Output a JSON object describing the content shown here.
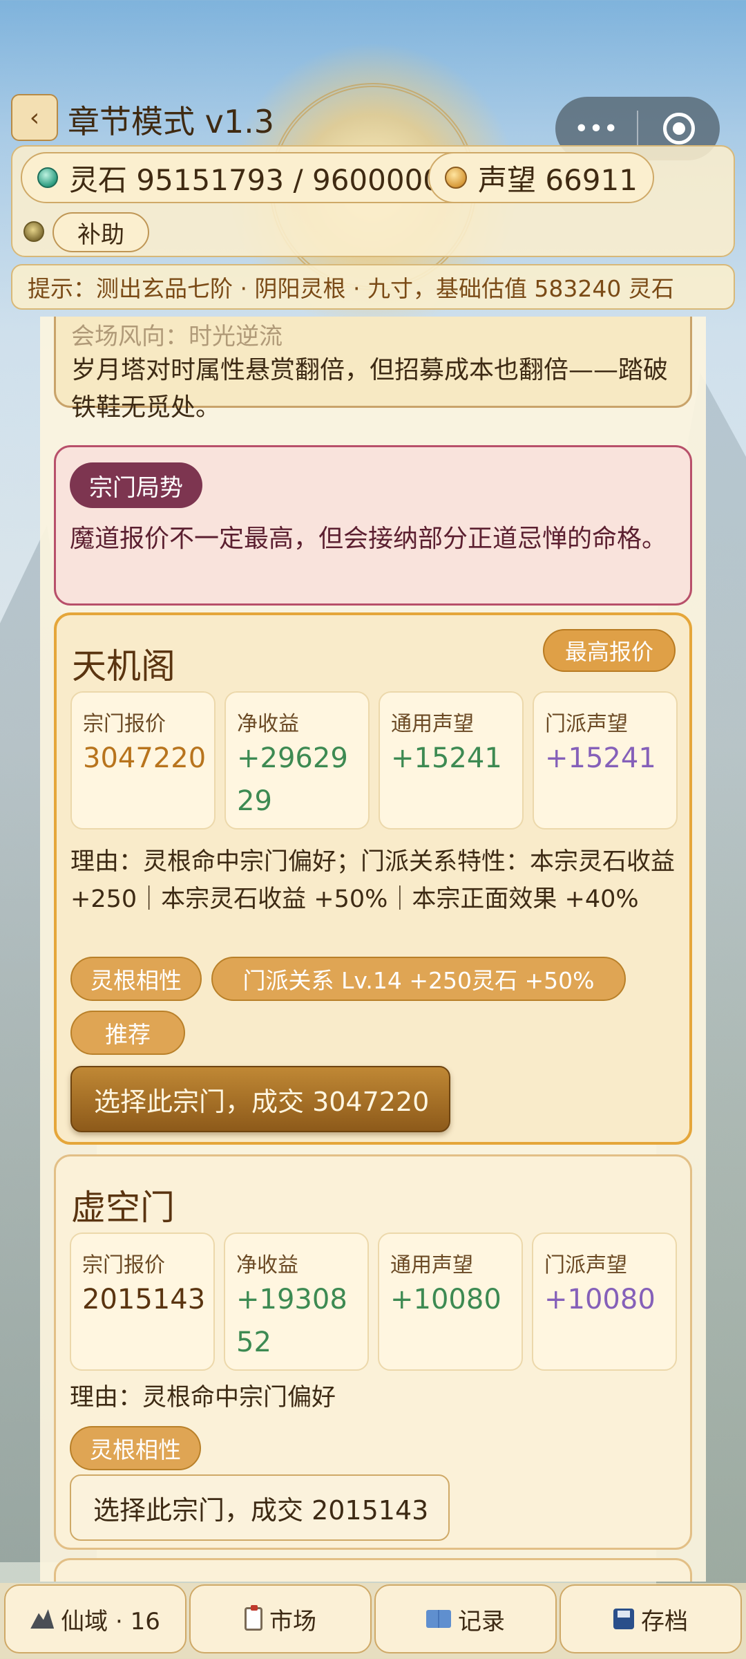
{
  "header": {
    "back_glyph": "‹",
    "title": "章节模式 v1.3",
    "capsule": {
      "menu_glyph": "•••"
    }
  },
  "resources": {
    "spirit_stone": "灵石 95151793 / 96000000",
    "reputation": "声望 66911",
    "assist_label": "补助"
  },
  "hint": "提示：测出玄品七阶 · 阴阳灵根 · 九寸，基础估值 583240 灵石",
  "event_card": {
    "ghost_title": "会场风向：时光逆流",
    "text": "岁月塔对时属性悬赏翻倍，但招募成本也翻倍——踏破铁鞋无觅处。"
  },
  "faction_card": {
    "tag": "宗门局势",
    "text": "魔道报价不一定最高，但会接纳部分正道忌惮的命格。"
  },
  "sects": [
    {
      "name": "天机阁",
      "badge": "最高报价",
      "stats": [
        {
          "label": "宗门报价",
          "value": "3047220"
        },
        {
          "label": "净收益",
          "value": "+2962929"
        },
        {
          "label": "通用声望",
          "value": "+15241"
        },
        {
          "label": "门派声望",
          "value": "+15241"
        }
      ],
      "reason": "理由：灵根命中宗门偏好；门派关系特性：本宗灵石收益 +250｜本宗灵石收益 +50%｜本宗正面效果 +40%",
      "chips": [
        "灵根相性",
        "门派关系 Lv.14 +250灵石 +50%",
        "推荐"
      ],
      "button": "选择此宗门，成交 3047220"
    },
    {
      "name": "虚空门",
      "stats": [
        {
          "label": "宗门报价",
          "value": "2015143"
        },
        {
          "label": "净收益",
          "value": "+1930852"
        },
        {
          "label": "通用声望",
          "value": "+10080"
        },
        {
          "label": "门派声望",
          "value": "+10080"
        }
      ],
      "reason": "理由：灵根命中宗门偏好",
      "chips": [
        "灵根相性"
      ],
      "button": "选择此宗门，成交 2015143"
    }
  ],
  "bottom_nav": [
    {
      "label": "仙域 · 16",
      "icon": "mountain-icon"
    },
    {
      "label": "市场",
      "icon": "clipboard-icon"
    },
    {
      "label": "记录",
      "icon": "book-icon"
    },
    {
      "label": "存档",
      "icon": "floppy-disk-icon"
    }
  ],
  "colors": {
    "accent_gold": "#dfa047",
    "faction_tag": "#7d3550",
    "positive_green": "#3d8a52",
    "sect_reputation_purple": "#8560b9",
    "offer_orange": "#b8741d"
  }
}
